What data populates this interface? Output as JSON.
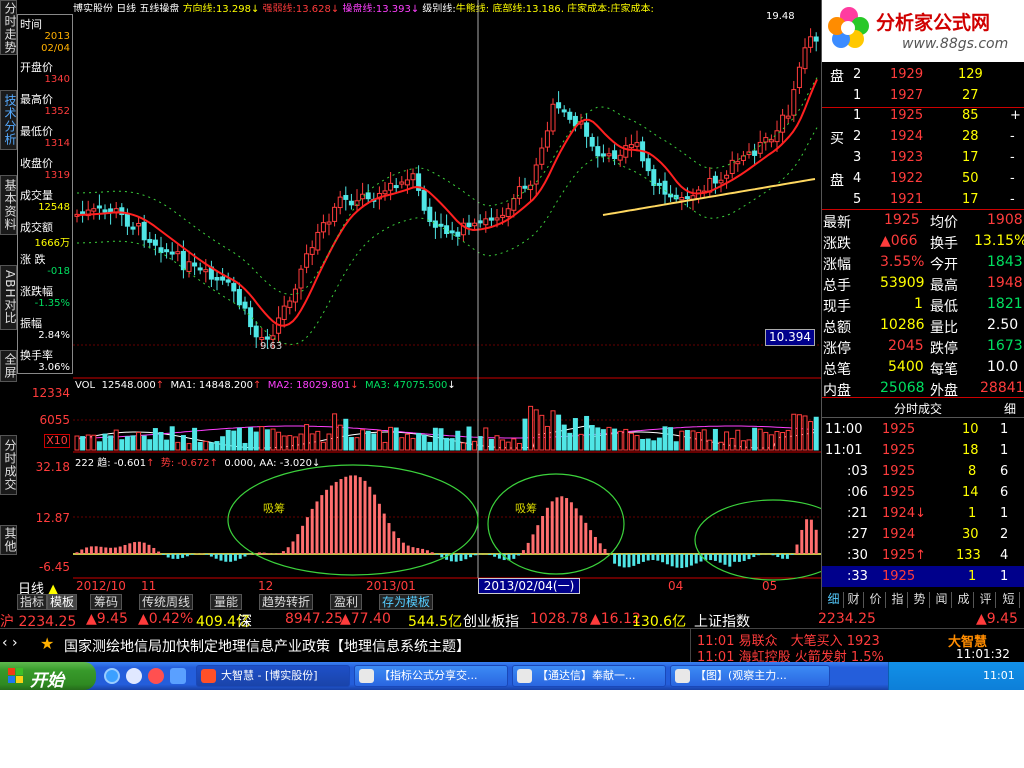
{
  "left_tabs": [
    "分时走势",
    "技术分析",
    "基本资料",
    "ABH对比",
    "全屏",
    "分时成交",
    "其他"
  ],
  "data_window": [
    {
      "label": "时间",
      "value": "2013"
    },
    {
      "label": "",
      "value": "02/04"
    },
    {
      "label": "开盘价",
      "value": "1340"
    },
    {
      "label": "最高价",
      "value": "1352"
    },
    {
      "label": "最低价",
      "value": "1314"
    },
    {
      "label": "收盘价",
      "value": "1319"
    },
    {
      "label": "成交量",
      "value": "12548"
    },
    {
      "label": "成交额",
      "value": "1666万"
    },
    {
      "label": "涨 跌",
      "value": "-018"
    },
    {
      "label": "涨跌幅",
      "value": "-1.35%"
    },
    {
      "label": "振幅",
      "value": "2.84%"
    },
    {
      "label": "换手率",
      "value": "3.06%"
    }
  ],
  "header": {
    "price_top": "19.48",
    "stock": "博实股份",
    "period": "日线",
    "indicator": "五线操盘",
    "lines": [
      {
        "name": "方向线:",
        "value": "13.298"
      },
      {
        "name": "强弱线:",
        "value": "13.628"
      },
      {
        "name": "操盘线:",
        "value": "13.393"
      },
      {
        "name": "级别线:",
        "value": "牛熊线:"
      },
      {
        "name": "底部线:",
        "value": "13.186,"
      },
      {
        "name": "庄家成本:",
        "value": "庄家成本:"
      }
    ]
  },
  "main_chart": {
    "low_label": "9.63",
    "price_box": "10.394"
  },
  "vol_panel": {
    "label": "VOL",
    "vol": "12548.000",
    "ma1": "MA1: 14848.200",
    "ma2": "MA2: 18029.801",
    "ma3": "MA3: 47075.500",
    "yticks": [
      "12334",
      "6055"
    ],
    "x_label": "X10"
  },
  "ind_panel": {
    "name": "222",
    "trend": "趋: -0.601",
    "shi": "势: -0.672",
    "v3": "0.000,",
    "aa": "AA: -3.020",
    "yticks": [
      "32.18",
      "12.87",
      "-6.45"
    ],
    "annotations": [
      "吸筹",
      "吸筹"
    ]
  },
  "x_axis": {
    "labels": [
      "2012/10",
      "11",
      "12",
      "2013/01",
      "04",
      "05"
    ],
    "cursor_date": "2013/02/04(一)",
    "period_label": "日线"
  },
  "chart_data": {
    "type": "candlestick",
    "price_range": [
      9.63,
      19.48
    ],
    "labeled_values": {
      "low": 9.63,
      "high": 19.48,
      "cursor_box": 10.394
    }
  },
  "bottom_tabs": [
    "指标",
    "模板",
    "筹码",
    "传统周线",
    "量能",
    "趋势转折",
    "盈利",
    "存为模板"
  ],
  "orderbook": {
    "sell_label": "盘",
    "sell": [
      {
        "n": "2",
        "price": "1929",
        "vol": "129"
      },
      {
        "n": "1",
        "price": "1927",
        "vol": "27"
      }
    ],
    "buy_label1": "买",
    "buy_label2": "盘",
    "buy": [
      {
        "n": "1",
        "price": "1925",
        "vol": "85",
        "chg": "+"
      },
      {
        "n": "2",
        "price": "1924",
        "vol": "28",
        "chg": "-"
      },
      {
        "n": "3",
        "price": "1923",
        "vol": "17",
        "chg": "-"
      },
      {
        "n": "4",
        "price": "1922",
        "vol": "50",
        "chg": "-"
      },
      {
        "n": "5",
        "price": "1921",
        "vol": "17",
        "chg": "-"
      }
    ]
  },
  "quote": [
    {
      "l1": "最新",
      "v1": "1925",
      "l2": "均价",
      "v2": "1908"
    },
    {
      "l1": "涨跌",
      "v1": "▲066",
      "l2": "换手",
      "v2": "13.15%"
    },
    {
      "l1": "涨幅",
      "v1": "3.55%",
      "l2": "今开",
      "v2": "1843"
    },
    {
      "l1": "总手",
      "v1": "53909",
      "l2": "最高",
      "v2": "1948"
    },
    {
      "l1": "现手",
      "v1": "1",
      "l2": "最低",
      "v2": "1821"
    },
    {
      "l1": "总额",
      "v1": "10286",
      "l2": "量比",
      "v2": "2.50"
    },
    {
      "l1": "涨停",
      "v1": "2045",
      "l2": "跌停",
      "v2": "1673"
    },
    {
      "l1": "总笔",
      "v1": "5400",
      "l2": "每笔",
      "v2": "10.0"
    },
    {
      "l1": "内盘",
      "v1": "25068",
      "l2": "外盘",
      "v2": "28841"
    }
  ],
  "ticks_header": {
    "title": "分时成交",
    "detail": "细"
  },
  "ticks": [
    {
      "t": "11:00",
      "p": "1925",
      "v": "10",
      "n": "1"
    },
    {
      "t": "11:01",
      "p": "1925",
      "v": "18",
      "n": "1"
    },
    {
      "t": ":03",
      "p": "1925",
      "v": "8",
      "n": "6"
    },
    {
      "t": ":06",
      "p": "1925",
      "v": "14",
      "n": "6"
    },
    {
      "t": ":21",
      "p": "1924↓",
      "v": "1",
      "n": "1"
    },
    {
      "t": ":27",
      "p": "1924",
      "v": "30",
      "n": "2"
    },
    {
      "t": ":30",
      "p": "1925↑",
      "v": "133",
      "n": "4"
    },
    {
      "t": ":33",
      "p": "1925",
      "v": "1",
      "n": "1"
    }
  ],
  "right_tabs": [
    "细",
    "财",
    "价",
    "指",
    "势",
    "闻",
    "成",
    "评",
    "短"
  ],
  "logo": {
    "title": "分析家公式网",
    "url": "www.88gs.com"
  },
  "index_bar": {
    "sh": "沪 2234.25",
    "sh_chg": "▲9.45",
    "sh_pct": "▲0.42%",
    "sh_amt": "409.4亿",
    "sz": "深",
    "sz_val": "8947.25",
    "sz_chg": "▲77.40",
    "sz_amt": "544.5亿",
    "cyb": "创业板指",
    "cyb_val": "1028.78",
    "cyb_chg": "▲16.12",
    "cyb_amt": "130.6亿",
    "shidx": "上证指数",
    "shidx_val": "2234.25",
    "shidx_chg": "▲9.45"
  },
  "news": {
    "text": "国家测绘地信局加快制定地理信息产业政策【地理信息系统主题】",
    "alert1": "11:01 易联众　大笔买入 1923",
    "alert2": "11:01 海虹控股 火箭发射 1.5%",
    "brand": "大智慧",
    "clock": "11:01:32"
  },
  "taskbar": {
    "start": "开始",
    "tasks": [
      "大智慧 - [博实股份]",
      "【指标公式分享交...",
      "【通达信】奉献一...",
      "【图】(观察主力..."
    ],
    "time": "11:01"
  }
}
